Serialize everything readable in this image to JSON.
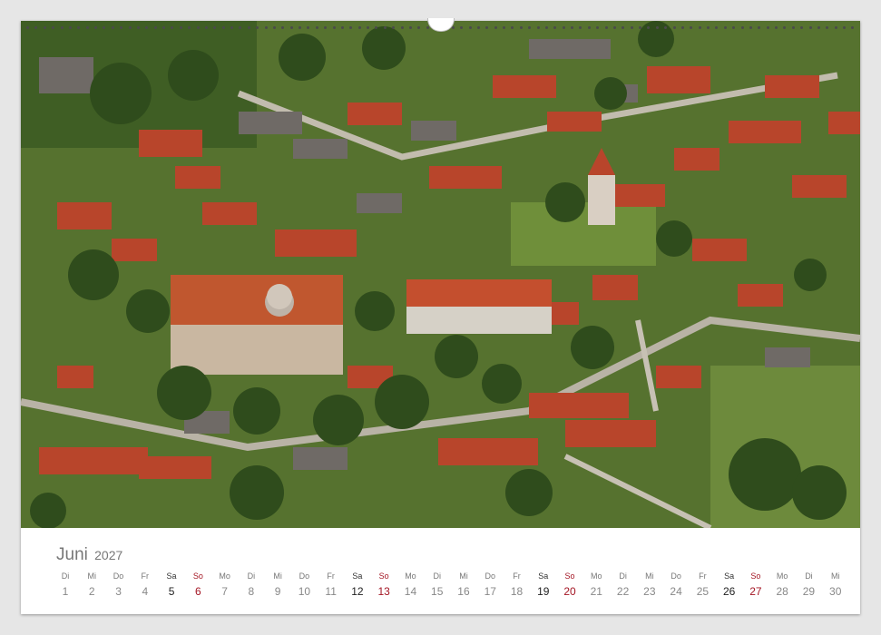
{
  "calendar": {
    "month": "Juni",
    "year": "2027",
    "days": [
      {
        "weekday": "Di",
        "day": "1",
        "type": "weekday"
      },
      {
        "weekday": "Mi",
        "day": "2",
        "type": "weekday"
      },
      {
        "weekday": "Do",
        "day": "3",
        "type": "weekday"
      },
      {
        "weekday": "Fr",
        "day": "4",
        "type": "weekday"
      },
      {
        "weekday": "Sa",
        "day": "5",
        "type": "sat"
      },
      {
        "weekday": "So",
        "day": "6",
        "type": "sun"
      },
      {
        "weekday": "Mo",
        "day": "7",
        "type": "weekday"
      },
      {
        "weekday": "Di",
        "day": "8",
        "type": "weekday"
      },
      {
        "weekday": "Mi",
        "day": "9",
        "type": "weekday"
      },
      {
        "weekday": "Do",
        "day": "10",
        "type": "weekday"
      },
      {
        "weekday": "Fr",
        "day": "11",
        "type": "weekday"
      },
      {
        "weekday": "Sa",
        "day": "12",
        "type": "sat"
      },
      {
        "weekday": "So",
        "day": "13",
        "type": "sun"
      },
      {
        "weekday": "Mo",
        "day": "14",
        "type": "weekday"
      },
      {
        "weekday": "Di",
        "day": "15",
        "type": "weekday"
      },
      {
        "weekday": "Mi",
        "day": "16",
        "type": "weekday"
      },
      {
        "weekday": "Do",
        "day": "17",
        "type": "weekday"
      },
      {
        "weekday": "Fr",
        "day": "18",
        "type": "weekday"
      },
      {
        "weekday": "Sa",
        "day": "19",
        "type": "sat"
      },
      {
        "weekday": "So",
        "day": "20",
        "type": "sun"
      },
      {
        "weekday": "Mo",
        "day": "21",
        "type": "weekday"
      },
      {
        "weekday": "Di",
        "day": "22",
        "type": "weekday"
      },
      {
        "weekday": "Mi",
        "day": "23",
        "type": "weekday"
      },
      {
        "weekday": "Do",
        "day": "24",
        "type": "weekday"
      },
      {
        "weekday": "Fr",
        "day": "25",
        "type": "weekday"
      },
      {
        "weekday": "Sa",
        "day": "26",
        "type": "sat"
      },
      {
        "weekday": "So",
        "day": "27",
        "type": "sun"
      },
      {
        "weekday": "Mo",
        "day": "28",
        "type": "weekday"
      },
      {
        "weekday": "Di",
        "day": "29",
        "type": "weekday"
      },
      {
        "weekday": "Mi",
        "day": "30",
        "type": "weekday"
      }
    ]
  },
  "colors": {
    "sunday": "#a41624",
    "saturday": "#222222",
    "weekday": "#888888"
  }
}
